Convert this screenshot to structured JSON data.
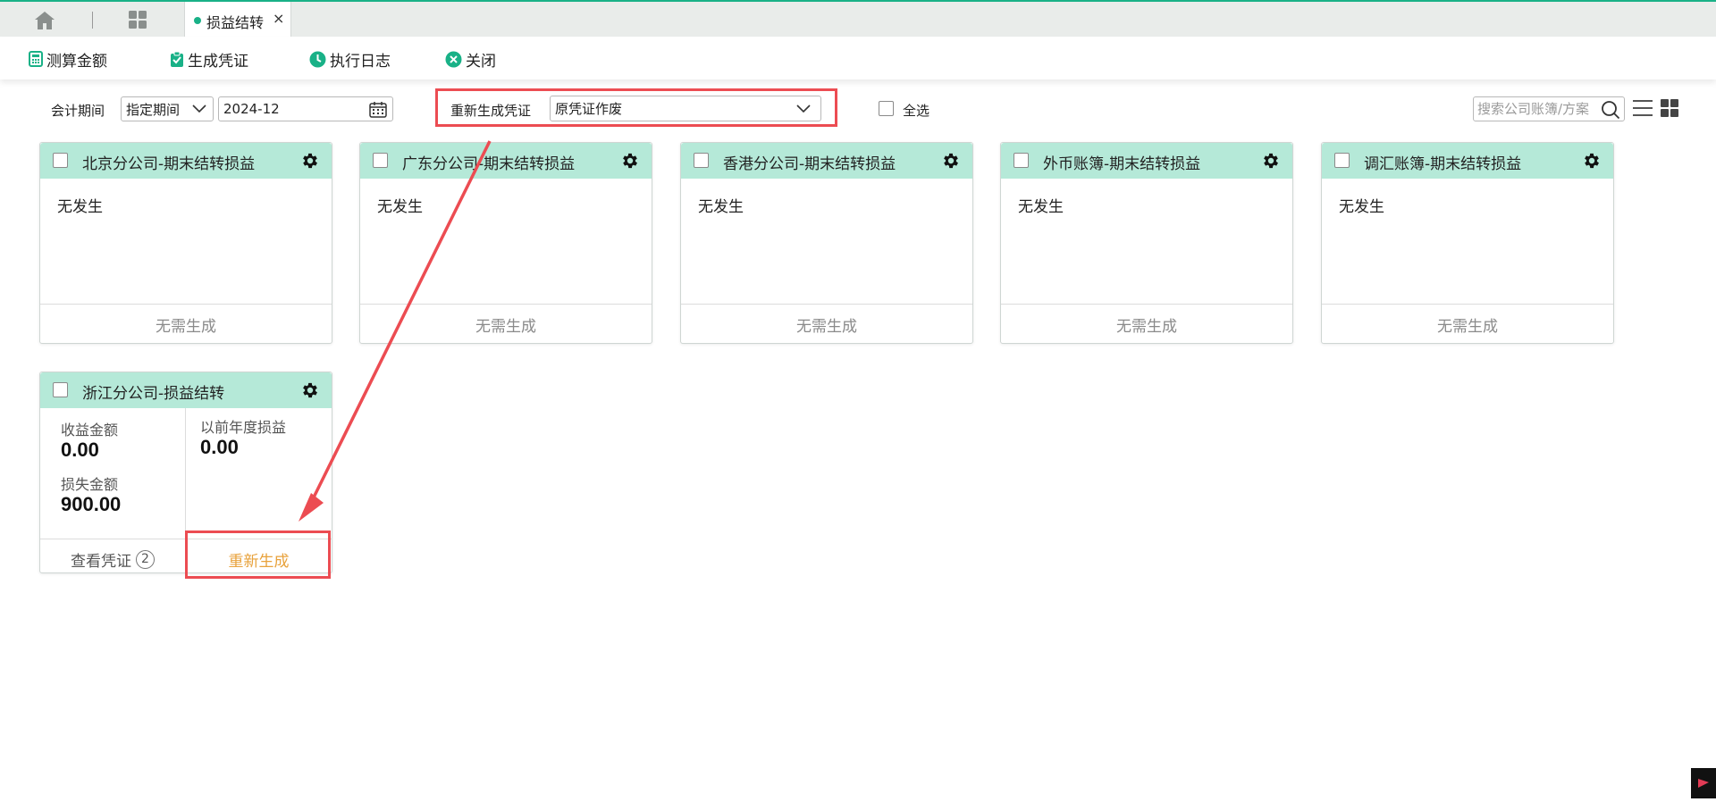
{
  "tabbar": {
    "home_icon": "home-icon",
    "apps_icon": "apps-grid-icon",
    "active_tab": {
      "label": "损益结转",
      "close": "×"
    }
  },
  "toolbar": {
    "buttons": [
      {
        "label": "测算金额",
        "icon": "calculator-icon"
      },
      {
        "label": "生成凭证",
        "icon": "clipboard-icon"
      },
      {
        "label": "执行日志",
        "icon": "clock-icon"
      },
      {
        "label": "关闭",
        "icon": "close-circle-icon"
      }
    ]
  },
  "filters": {
    "period_label": "会计期间",
    "period_mode": "指定期间",
    "period_value": "2024-12",
    "regen_label": "重新生成凭证",
    "regen_option": "原凭证作废",
    "select_all_label": "全选",
    "search_placeholder": "搜索公司账簿/方案"
  },
  "cards": [
    {
      "title": "北京分公司-期末结转损益",
      "body": "无发生",
      "footer": "无需生成"
    },
    {
      "title": "广东分公司-期末结转损益",
      "body": "无发生",
      "footer": "无需生成"
    },
    {
      "title": "香港分公司-期末结转损益",
      "body": "无发生",
      "footer": "无需生成"
    },
    {
      "title": "外币账簿-期末结转损益",
      "body": "无发生",
      "footer": "无需生成"
    },
    {
      "title": "调汇账簿-期末结转损益",
      "body": "无发生",
      "footer": "无需生成"
    }
  ],
  "zhejiang_card": {
    "title": "浙江分公司-损益结转",
    "income_label": "收益金额",
    "income_value": "0.00",
    "loss_label": "损失金额",
    "loss_value": "900.00",
    "prior_label": "以前年度损益",
    "prior_value": "0.00",
    "view_voucher_label": "查看凭证",
    "view_voucher_count": "2",
    "regenerate_label": "重新生成"
  },
  "colors": {
    "accent": "#19b187",
    "card_header": "#b5e9d8",
    "highlight": "#ec4c52",
    "regenerate": "#e8a23c"
  }
}
